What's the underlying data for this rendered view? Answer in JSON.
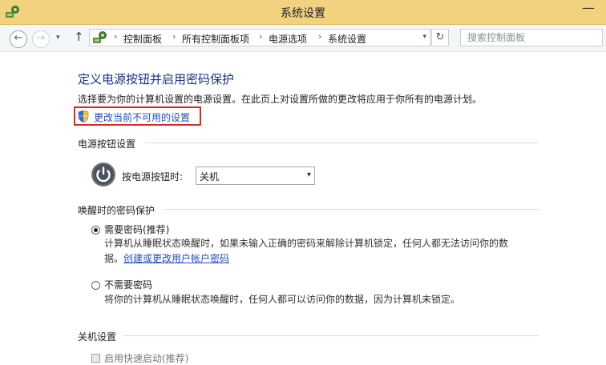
{
  "window": {
    "title": "系统设置",
    "minimize_symbol": "—"
  },
  "navigation": {
    "back_symbol": "←",
    "forward_symbol": "→",
    "dropdown_symbol": "▾",
    "up_symbol": "↑",
    "breadcrumb_separator": "›",
    "breadcrumbs": [
      "控制面板",
      "所有控制面板项",
      "电源选项",
      "系统设置"
    ],
    "refresh_symbol": "↻",
    "search_placeholder": "搜索控制面板"
  },
  "page": {
    "title": "定义电源按钮并启用密码保护",
    "description": "选择要为你的计算机设置的电源设置。在此页上对设置所做的更改将应用于你所有的电源计划。",
    "change_link": "更改当前不可用的设置"
  },
  "power_button_section": {
    "heading": "电源按钮设置",
    "label": "按电源按钮时:",
    "selected": "关机",
    "arrow_symbol": "▾"
  },
  "wake_password_section": {
    "heading": "唤醒时的密码保护",
    "options": [
      {
        "label": "需要密码(推荐)",
        "desc_line1": "计算机从睡眠状态唤醒时，如果未输入正确的密码来解除计算机锁定，任何人都无法访问你的数",
        "desc_line2_prefix": "据。",
        "desc_link": "创建或更改用户帐户密码",
        "selected": true
      },
      {
        "label": "不需要密码",
        "desc_line1": "将你的计算机从睡眠状态唤醒时，任何人都可以访问你的数据，因为计算机未锁定。",
        "selected": false
      }
    ]
  },
  "shutdown_section": {
    "heading": "关机设置",
    "checkbox_label": "启用快速启动(推荐)"
  },
  "colors": {
    "title_bar": "#f3d27f",
    "title_text": "#1e3287",
    "link": "#1f4ec2",
    "highlight_border": "#d42a2a"
  },
  "icons": {
    "window": "control-panel-icon",
    "location": "control-panel-icon",
    "shield": "uac-shield-icon",
    "power": "power-icon"
  }
}
